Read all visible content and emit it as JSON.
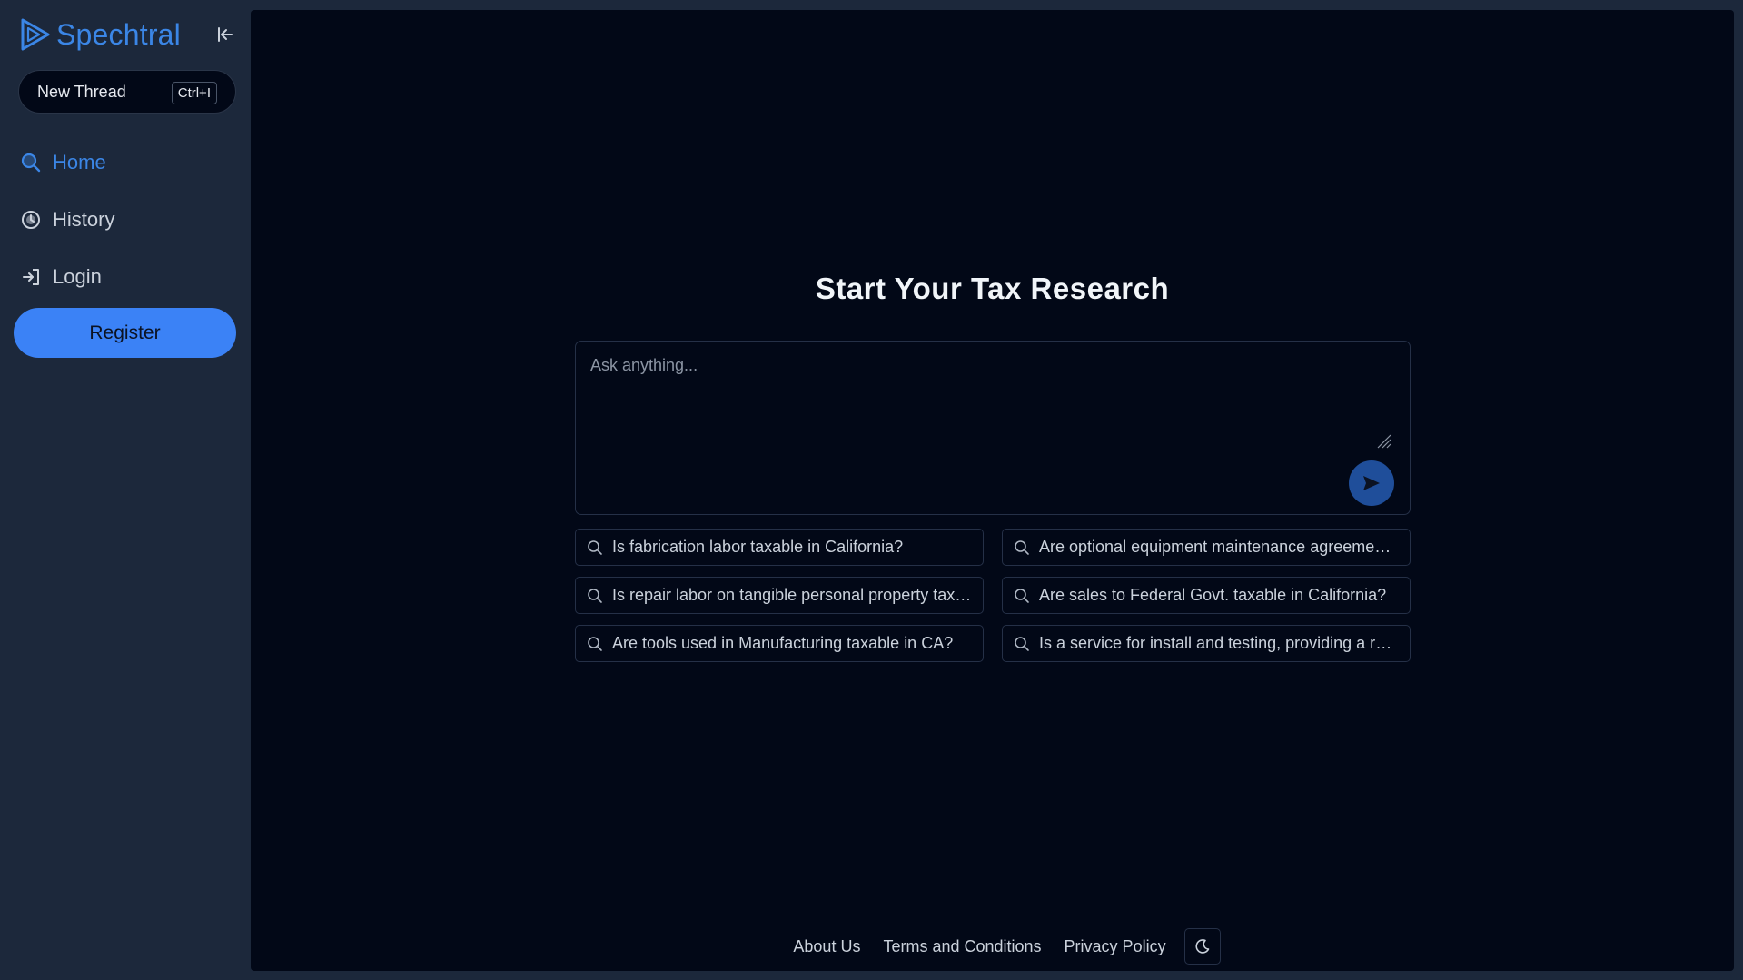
{
  "brand": {
    "name": "Spechtral"
  },
  "sidebar": {
    "new_thread": {
      "label": "New Thread",
      "shortcut": "Ctrl+I"
    },
    "nav": [
      {
        "label": "Home",
        "icon": "search-icon",
        "active": true
      },
      {
        "label": "History",
        "icon": "history-icon",
        "active": false
      },
      {
        "label": "Login",
        "icon": "login-icon",
        "active": false
      }
    ],
    "register_label": "Register"
  },
  "main": {
    "title": "Start Your Tax Research",
    "ask": {
      "placeholder": "Ask anything...",
      "value": ""
    },
    "suggestions": [
      "Is fabrication labor taxable in California?",
      "Are optional equipment maintenance agreements taxable in California?",
      "Is repair labor on tangible personal property taxable in California?",
      "Are sales to Federal Govt. taxable in California?",
      "Are tools used in Manufacturing taxable in CA?",
      "Is a service for install and testing, providing a report taxable?"
    ]
  },
  "footer": {
    "links": [
      "About Us",
      "Terms and Conditions",
      "Privacy Policy"
    ],
    "theme_toggle_icon": "moon-icon"
  },
  "colors": {
    "accent": "#3b86e6",
    "button": "#3b82f6",
    "sidebar_bg": "#1c283b",
    "main_bg": "#020817",
    "send_button": "#1f4e9a"
  }
}
